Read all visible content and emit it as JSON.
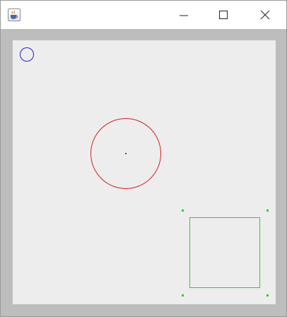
{
  "window": {
    "app_icon": "java-coffee-cup-icon",
    "controls": [
      "minimize-icon",
      "maximize-icon",
      "close-icon"
    ]
  },
  "canvas": {
    "background": "#ededed",
    "frame_color": "#bdbdbd",
    "small_circle_color": "#1f1fd6",
    "large_circle_color": "#d61f1f",
    "center_dot_color": "#d61f1f",
    "square_color": "#1fd61f",
    "handle_color": "#1fd61f"
  }
}
